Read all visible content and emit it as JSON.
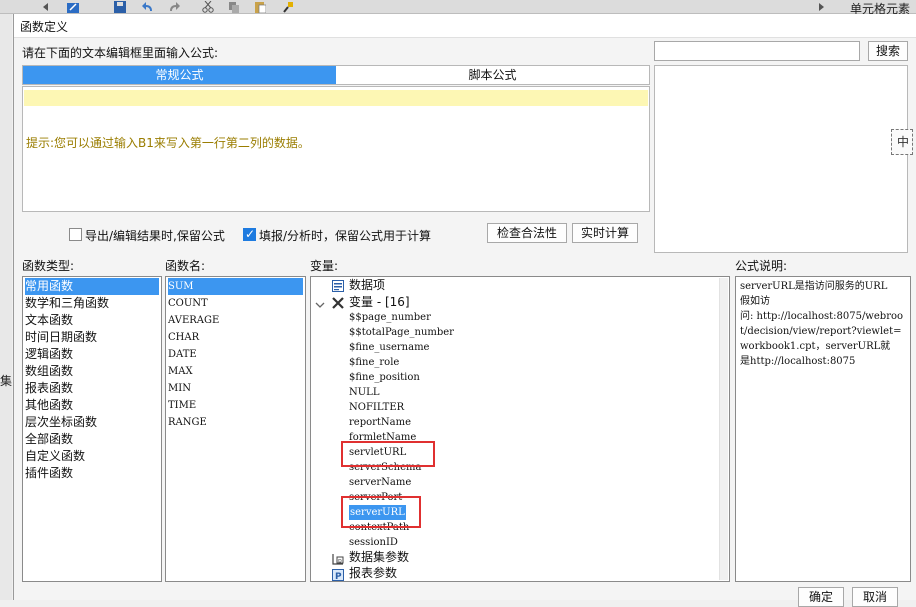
{
  "background": {
    "right_label": "单元格元素",
    "left_label": "集"
  },
  "dialog": {
    "title": "函数定义",
    "prompt": "请在下面的文本编辑框里面输入公式:",
    "search_button": "搜索",
    "search_value": "",
    "tabs": [
      {
        "label": "常规公式",
        "selected": true
      },
      {
        "label": "脚本公式",
        "selected": false
      }
    ],
    "editor_value": "",
    "hint": "提示:您可以通过输入B1来写入第一行第二列的数据。",
    "preview_partial_char": "中",
    "option1": {
      "label": "导出/编辑结果时,保留公式",
      "checked": false
    },
    "option2": {
      "label": "填报/分析时，保留公式用于计算",
      "checked": true
    },
    "check_button": "检查合法性",
    "calc_button": "实时计算",
    "ok_button": "确定",
    "cancel_button": "取消"
  },
  "function_types": {
    "label": "函数类型:",
    "items": [
      "常用函数",
      "数学和三角函数",
      "文本函数",
      "时间日期函数",
      "逻辑函数",
      "数组函数",
      "报表函数",
      "其他函数",
      "层次坐标函数",
      "全部函数",
      "自定义函数",
      "插件函数"
    ],
    "selected_index": 0
  },
  "function_names": {
    "label": "函数名:",
    "items": [
      "SUM",
      "COUNT",
      "AVERAGE",
      "CHAR",
      "DATE",
      "MAX",
      "MIN",
      "TIME",
      "RANGE"
    ],
    "selected_index": 0
  },
  "variables": {
    "label": "变量:",
    "data_items": "数据项",
    "var_group": "变量 - [16]",
    "vars": [
      "$$page_number",
      "$$totalPage_number",
      "$fine_username",
      "$fine_role",
      "$fine_position",
      "NULL",
      "NOFILTER",
      "reportName",
      "formletName",
      "servletURL",
      "serverSchema",
      "serverName",
      "serverPort",
      "serverURL",
      "contextPath",
      "sessionID"
    ],
    "selected_var": "serverURL",
    "dataset_params": "数据集参数",
    "report_params": "报表参数",
    "marker_color": "#e03030",
    "selection_color": "#3c96f0"
  },
  "description": {
    "label": "公式说明:",
    "text": "serverURL是指访问服务的URL\n假如访\n问: http://localhost:8075/webroot/decision/view/report?viewlet=workbook1.cpt，serverURL就\n是http://localhost:8075"
  }
}
